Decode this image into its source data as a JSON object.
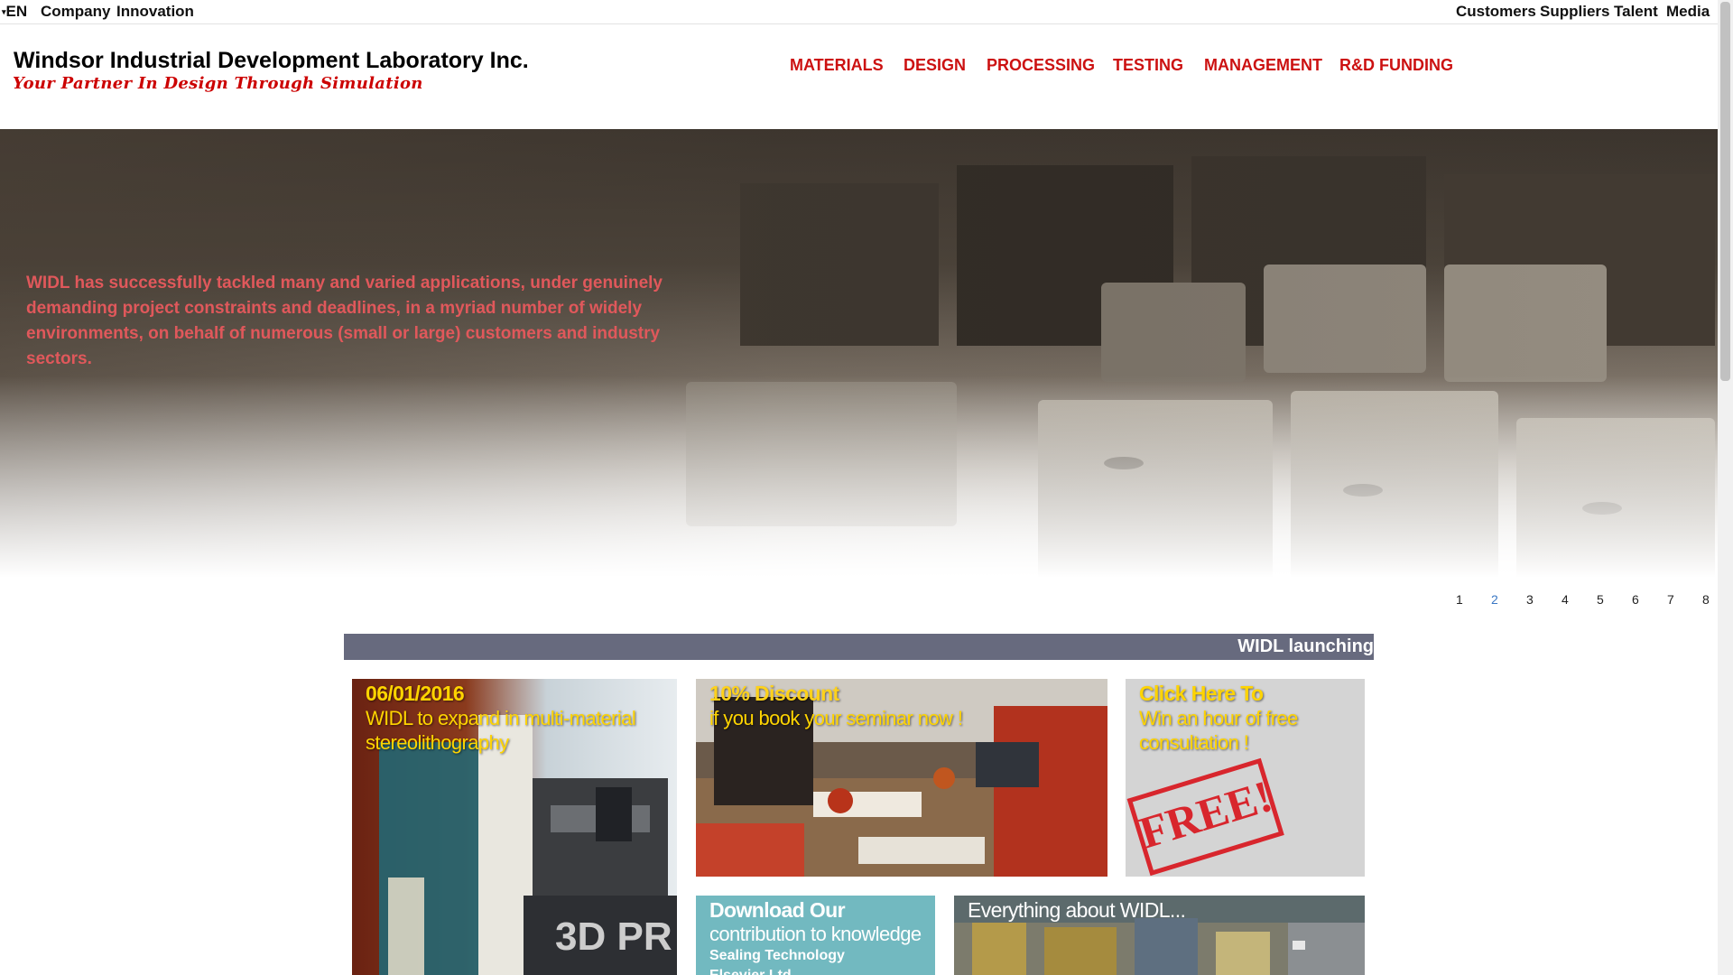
{
  "utility_nav": {
    "language": "EN",
    "left_items": [
      "Company",
      "Innovation"
    ],
    "right_items": [
      "Customers",
      "Suppliers",
      "Talent",
      "Media"
    ]
  },
  "brand": {
    "name": "Windsor Industrial Development Laboratory Inc.",
    "tagline": "Your Partner In Design Through Simulation"
  },
  "main_nav": [
    "MATERIALS",
    "DESIGN",
    "PROCESSING",
    "TESTING",
    "MANAGEMENT",
    "R&D FUNDING"
  ],
  "hero": {
    "text": "WIDL has successfully tackled many and varied applications, under genuinely demanding project constraints and deadlines, in a myriad number of widely environments, on behalf of numerous (small or large) customers and industry sectors."
  },
  "pager": {
    "pages": [
      "1",
      "2",
      "3",
      "4",
      "5",
      "6",
      "7",
      "8"
    ],
    "active": "2"
  },
  "section": {
    "title": "WIDL launching"
  },
  "tiles": {
    "news": {
      "date": "06/01/2016",
      "text": "WIDL to expand in multi-material stereolithography",
      "image_label": "3D PR"
    },
    "discount": {
      "heading": "10% Discount",
      "text": "if you book your seminar now !"
    },
    "consultation": {
      "heading": "Click Here To",
      "text": "Win an hour of free consultation !",
      "stamp": "FREE!"
    },
    "download": {
      "heading": "Download Our",
      "text": "contribution to knowledge",
      "item1": "Sealing Technology",
      "item2": "Elsevier Ltd"
    },
    "about": {
      "heading": "Everything about WIDL..."
    }
  },
  "colors": {
    "accent_red": "#cc1111",
    "section_bar": "#676a7e",
    "headline_yellow": "#ffd400",
    "teal": "#72b9c0"
  }
}
